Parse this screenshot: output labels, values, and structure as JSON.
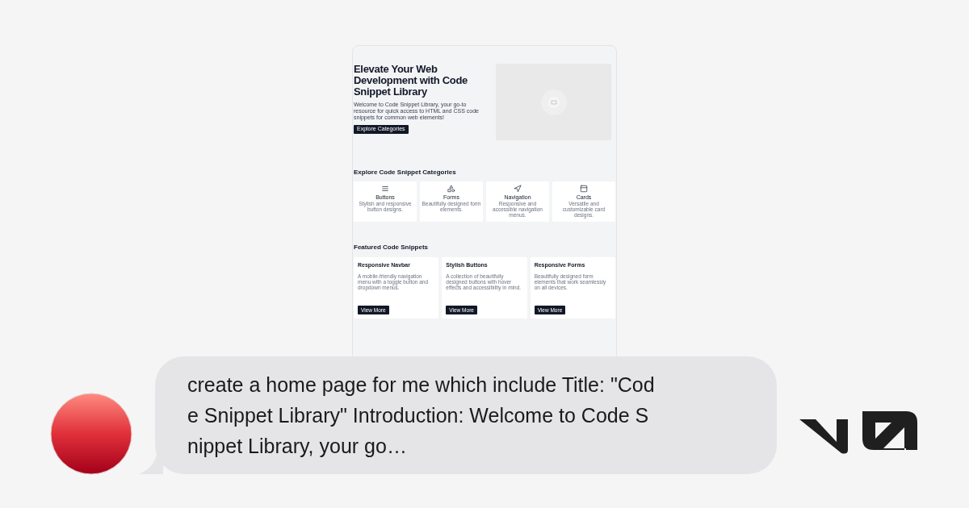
{
  "preview": {
    "hero": {
      "title": "Elevate Your Web Development with Code Snippet Library",
      "intro": "Welcome to Code Snippet Library, your go-to resource for quick access to HTML and CSS code snippets for common web elements!",
      "button": "Explore Categories"
    },
    "categories": {
      "heading": "Explore Code Snippet Categories",
      "items": [
        {
          "kind": "menu",
          "name": "Buttons",
          "description": "Stylish and responsive button designs."
        },
        {
          "kind": "shapes",
          "name": "Forms",
          "description": "Beautifully designed form elements."
        },
        {
          "kind": "navigation",
          "name": "Navigation",
          "description": "Responsive and accessible navigation menus."
        },
        {
          "kind": "card",
          "name": "Cards",
          "description": "Versatile and customizable card designs."
        }
      ]
    },
    "featured": {
      "heading": "Featured Code Snippets",
      "items": [
        {
          "title": "Responsive Navbar",
          "description": "A mobile-friendly navigation menu with a toggle button and dropdown menus.",
          "button": "View More"
        },
        {
          "title": "Stylish Buttons",
          "description": "A collection of beautifully designed buttons with hover effects and accessibility in mind.",
          "button": "View More"
        },
        {
          "title": "Responsive Forms",
          "description": "Beautifully designed form elements that work seamlessly on all devices.",
          "button": "View More"
        }
      ]
    }
  },
  "prompt": {
    "lines": [
      "create a home page for me which include Title: \"Cod",
      "e Snippet Library\" Introduction: Welcome to Code S",
      "nippet Library, your go…"
    ]
  }
}
